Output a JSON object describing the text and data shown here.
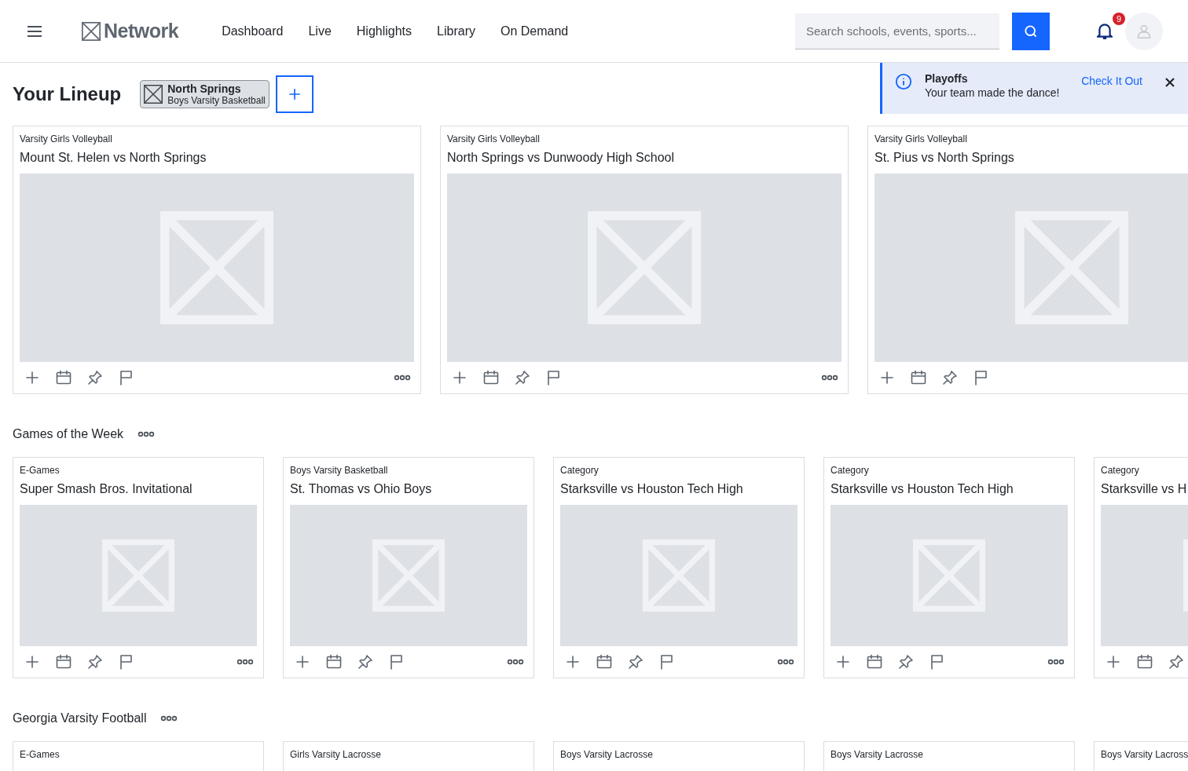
{
  "header": {
    "logo": "Network",
    "nav": [
      "Dashboard",
      "Live",
      "Highlights",
      "Library",
      "On Demand"
    ],
    "search": {
      "placeholder": "Search schools, events, sports..."
    },
    "notifications": "9"
  },
  "lineup": {
    "title": "Your Lineup",
    "teams": [
      {
        "name": "North Springs",
        "team": "Boys Varsity Basketball"
      }
    ]
  },
  "toast": {
    "title": "Playoffs",
    "message": "Your team made the dance!",
    "action": "Check It Out"
  },
  "featured": [
    {
      "category": "Varsity Girls Volleyball",
      "title": "Mount St. Helen vs North Springs",
      "actions": [
        {
          "kind": "add"
        },
        {
          "kind": "calendar"
        },
        {
          "kind": "pin"
        },
        {
          "kind": "flag"
        },
        {
          "kind": "more"
        }
      ]
    },
    {
      "category": "Varsity Girls Volleyball",
      "title": "North Springs vs Dunwoody High School",
      "actions": [
        {
          "kind": "add"
        },
        {
          "kind": "calendar"
        },
        {
          "kind": "pin"
        },
        {
          "kind": "flag"
        },
        {
          "kind": "more"
        }
      ]
    },
    {
      "category": "Varsity Girls Volleyball",
      "title": "St. Pius vs North Springs",
      "actions": [
        {
          "kind": "add"
        },
        {
          "kind": "calendar"
        },
        {
          "kind": "pin"
        },
        {
          "kind": "flag"
        }
      ]
    }
  ],
  "sections": [
    {
      "title": "Games of the Week",
      "cards": [
        {
          "category": "E-Games",
          "title": "Super Smash Bros. Invitational",
          "actions": [
            {
              "kind": "add"
            },
            {
              "kind": "calendar"
            },
            {
              "kind": "pin"
            },
            {
              "kind": "flag"
            },
            {
              "kind": "more"
            }
          ]
        },
        {
          "category": "Boys Varsity Basketball",
          "title": "St. Thomas vs Ohio Boys",
          "actions": [
            {
              "kind": "add"
            },
            {
              "kind": "calendar"
            },
            {
              "kind": "pin"
            },
            {
              "kind": "flag"
            },
            {
              "kind": "more"
            }
          ]
        },
        {
          "category": "Category",
          "title": "Starksville vs Houston Tech High",
          "actions": [
            {
              "kind": "add"
            },
            {
              "kind": "calendar"
            },
            {
              "kind": "pin"
            },
            {
              "kind": "flag"
            },
            {
              "kind": "more"
            }
          ]
        },
        {
          "category": "Category",
          "title": "Starksville vs Houston Tech High",
          "actions": [
            {
              "kind": "add"
            },
            {
              "kind": "calendar"
            },
            {
              "kind": "pin"
            },
            {
              "kind": "flag"
            },
            {
              "kind": "more"
            }
          ]
        },
        {
          "category": "Category",
          "title": "Starksville vs H",
          "actions": [
            {
              "kind": "add"
            },
            {
              "kind": "calendar"
            },
            {
              "kind": "pin"
            }
          ]
        }
      ]
    },
    {
      "title": "Georgia Varsity Football",
      "cards": [
        {
          "category": "E-Games"
        },
        {
          "category": "Girls Varsity Lacrosse"
        },
        {
          "category": "Boys Varsity Lacrosse"
        },
        {
          "category": "Boys Varsity Lacrosse"
        },
        {
          "category": "Boys Varsity Lacross"
        }
      ]
    }
  ]
}
